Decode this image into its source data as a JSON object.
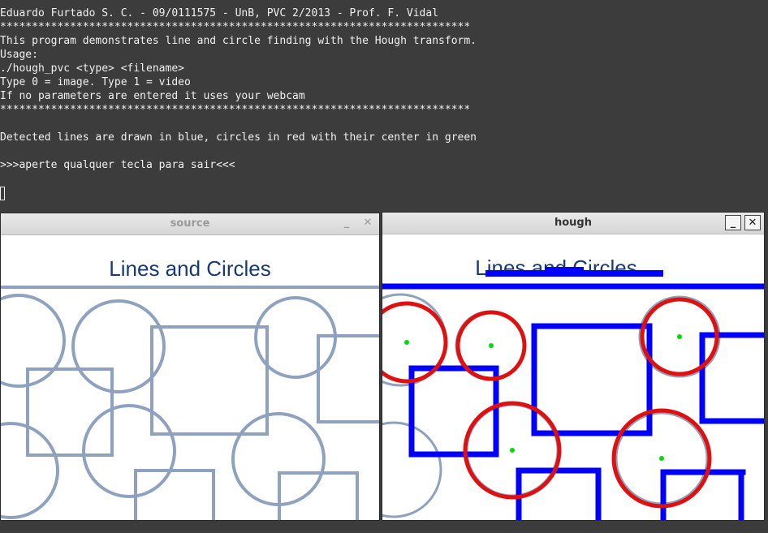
{
  "terminal": {
    "lines": [
      "Eduardo Furtado S. C. - 09/0111575 - UnB, PVC 2/2013 - Prof. F. Vidal",
      "**************************************************************************",
      "This program demonstrates line and circle finding with the Hough transform.",
      "Usage:",
      "./hough_pvc <type> <filename>",
      "Type 0 = image. Type 1 = video",
      "If no parameters are entered it uses your webcam",
      "**************************************************************************",
      "",
      "Detected lines are drawn in blue, circles in red with their center in green",
      "",
      ">>>aperte qualquer tecla para sair<<<"
    ]
  },
  "windows": {
    "source": {
      "title": "source",
      "minimize_label": "_",
      "close_label": "✕",
      "image_title": "Lines and Circles"
    },
    "hough": {
      "title": "hough",
      "minimize_label": "_",
      "close_label": "✕",
      "image_title": "Lines and Circles"
    }
  },
  "colors": {
    "terminal_bg": "#3c3c3c",
    "terminal_text": "#f0f0f0",
    "shape_stroke": "#8ea2bf",
    "title_text": "#163a78",
    "detected_line": "#0000ff",
    "detected_circle": "#e01010",
    "circle_center": "#00dd00"
  }
}
